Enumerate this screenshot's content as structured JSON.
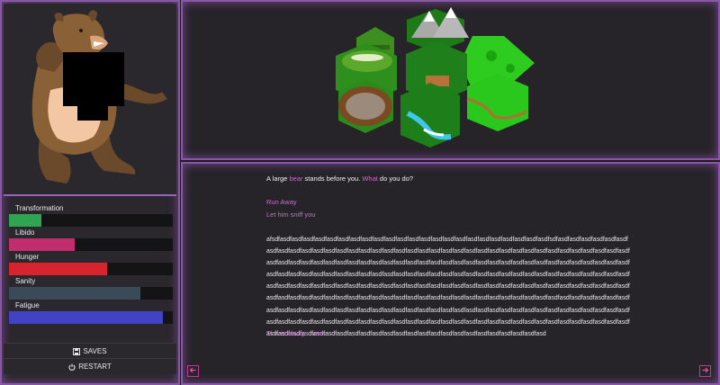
{
  "sidebar": {
    "stats": [
      {
        "label": "Transformation",
        "value": 0.2,
        "color": "#2fa552"
      },
      {
        "label": "Libido",
        "value": 0.4,
        "color": "#c12e6e"
      },
      {
        "label": "Hunger",
        "value": 0.6,
        "color": "#d8242e"
      },
      {
        "label": "Sanity",
        "value": 0.8,
        "color": "#3a4a59"
      },
      {
        "label": "Fatigue",
        "value": 0.94,
        "color": "#4243c4"
      }
    ],
    "saves_label": "SAVES",
    "restart_label": "RESTART"
  },
  "story": {
    "prefix": "A large ",
    "bear": "bear",
    "middle": " stands before you. ",
    "what": "What",
    "suffix": " do you do?",
    "choices": [
      "Run Away",
      "Let him sniff you"
    ],
    "filler": "afsdfasdfasdfasdfasdfasdfasdfasdfasdfasdfasdfasdfasdfasdfasdfasdfasdfasdfasdfasdfasdfasdfasdfasdfsdfasdfasdfasdfasdfasdfasdfasdfasdfasdfasdfasdfasdfasdfasdfasdfasdfasdfasdfasdfasdfasdfasdfasdfasdfasdfasdfasdfasdfasdfasdfasdfasdfasdfasdfasdfasdfasdfasdfasdfasdfasdfasdfasdfasdfasdfasdfasdfasdfasdfasdfasdfasdfasdfasdfasdfasdfasdfasdfasdfasdfasdfasdfasdfasdfasdfasdfasdfasdfasdfasdfasdfasdfasdfasdfasdfasdfasdfasdfasdfasdfasdfasdfasdfasdfasdfasdfasdfasdfasdfasdfasdfasdfasdfasdfasdfasdfasdfasdfasdfasdfasdfasdfasdfasdfasdfasdfasdfasdfasdfasdfasdfasdfasdfasdfasdfasdfasdfasdfasdfasdfasdfasdfasdfasdfasdfasdfasdfasdfasdfasdfasdfasdfasdfasdfasdfasdfasdfasdfasdfasdfasdfasdfasdfasdfasdfasdfasdfasdfasdfasdfasdfasdfasdfasdfasdfasdfasdfasdfasdfasdfasdfasdfasdfasdfasdfasdfasdfasdfasdfasdfasdfasdfasdfasdfasdfasdfasdfasdfasdfasdfasdfasdfasdfasdfasdfasdfasdfasdfasdfasdfasdfasdfasdfasdfasdfasdfasdfasdfasdfasdfasdfasdfasdfasdfasdfasdfasdfasdfasdfasdfasdfasdfasdfasdfasdfasdfasdfasdfasdfasdfasdfasdfasdfasdfasdfasdfasdfasdfasdfasdfasdfasdfasdfasdfasdfasdfasdfasdfasdfasdfasdfasdfasdfasdfasdfasdfasd",
    "persistent": "This is always here."
  },
  "nav": {
    "prev_icon": "arrow-left-icon",
    "next_icon": "arrow-right-icon"
  },
  "colors": {
    "accent": "#c174c9",
    "panel_border": "#8a57a8"
  }
}
